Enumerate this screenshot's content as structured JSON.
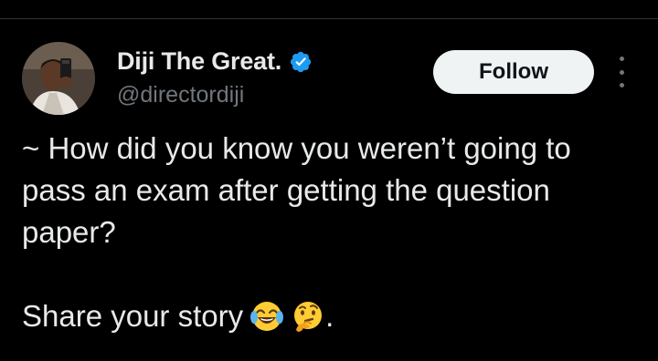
{
  "author": {
    "display_name": "Diji The Great.",
    "handle": "@directordiji",
    "verified_color": "#1d9bf0"
  },
  "actions": {
    "follow_label": "Follow"
  },
  "tweet": {
    "lines": [
      "~ How did you know you weren’t going to",
      "pass an exam after getting the question",
      "paper?"
    ],
    "story_text": "Share your story",
    "emojis": [
      "face-with-tears-of-joy-icon",
      "thinking-face-icon"
    ],
    "trailing_punctuation": "."
  },
  "colors": {
    "background": "#000000",
    "text_primary": "#e7e9ea",
    "text_secondary": "#71767b",
    "button_bg": "#eff3f4"
  }
}
